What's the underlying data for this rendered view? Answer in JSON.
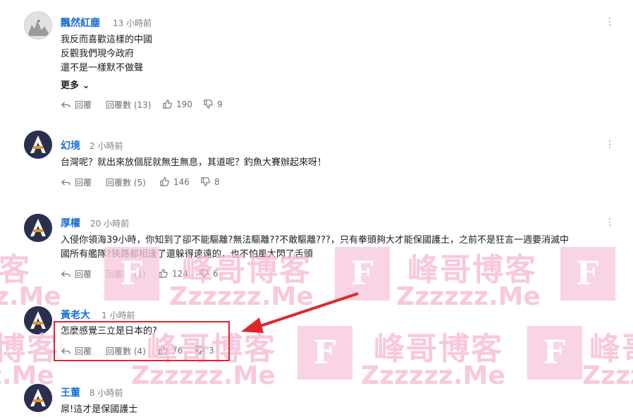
{
  "comments": [
    {
      "username": "飄然紅塵",
      "time": "13 小時前",
      "lines": [
        "我反而喜歡這樣的中國",
        "反觀我們現今政府",
        "還不是一樣默不做聲"
      ],
      "more": "更多",
      "reply": "回覆",
      "reply_count": "回覆數 (13)",
      "likes": "190",
      "dislikes": "9",
      "avatar": "photo"
    },
    {
      "username": "幻境",
      "time": "2 小時前",
      "lines": [
        "台灣呢？就出來放個屁就無生無息，其道呢？釣魚大賽辦起來呀！"
      ],
      "reply": "回覆",
      "reply_count": "回覆數 (5)",
      "likes": "146",
      "dislikes": "8",
      "avatar": "A"
    },
    {
      "username": "厚權",
      "time": "20 小時前",
      "lines": [
        "入侵你領海39小時，你知到了卻不能驅離?無法驅離??不敢驅離???，只有拳頭夠大才能保國護土，之前不是狂言一週要消滅中",
        "國所有艦隊?狹路都相逢了還躲得遠遠的，也不怕風大閃了舌頭"
      ],
      "reply": "回覆",
      "reply_count": "回覆數 (1)",
      "likes": "124",
      "dislikes": "6",
      "avatar": "A"
    },
    {
      "username": "黃老大",
      "time": "1 小時前",
      "lines": [
        "怎麼感覺三立是日本的?"
      ],
      "reply": "回覆",
      "reply_count": "回覆數 (4)",
      "likes": "76",
      "dislikes": "3",
      "avatar": "A"
    },
    {
      "username": "王董",
      "time": "8 小時前",
      "lines": [
        "屌!這才是保國護士"
      ],
      "avatar": "A"
    }
  ],
  "watermark": {
    "chinese": "峰哥博客",
    "url": "Zzzzzz.Me",
    "letter": "F"
  },
  "colors": {
    "username": "#1a6fd6",
    "highlight": "#e0262c",
    "watermark": "#f6c6dc"
  }
}
